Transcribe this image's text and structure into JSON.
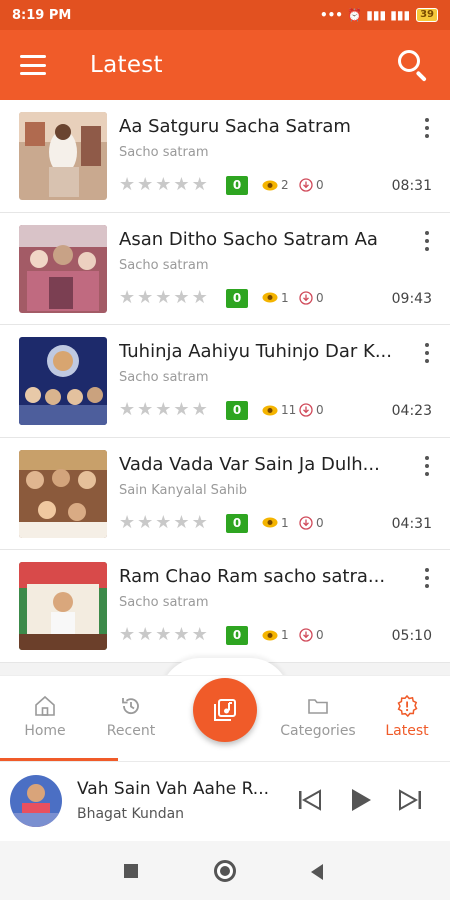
{
  "status_bar": {
    "time": "8:19 PM",
    "indicators": "••• ⏰ ▮▮▮ ▮▮▮",
    "battery": "39"
  },
  "app_bar": {
    "title": "Latest",
    "menu_icon": "menu-icon",
    "search_icon": "search-icon"
  },
  "colors": {
    "accent": "#f05b29",
    "badge": "#2ea521"
  },
  "songs": [
    {
      "title": "Aa Satguru Sacha Satram",
      "artist": "Sacho satram",
      "rating": "0",
      "views": "2",
      "downloads": "0",
      "duration": "08:31"
    },
    {
      "title": "Asan Ditho Sacho Satram Aa",
      "artist": "Sacho satram",
      "rating": "0",
      "views": "1",
      "downloads": "0",
      "duration": "09:43"
    },
    {
      "title": "Tuhinja Aahiyu Tuhinjo Dar K...",
      "artist": "Sacho satram",
      "rating": "0",
      "views": "11",
      "downloads": "0",
      "duration": "04:23"
    },
    {
      "title": "Vada Vada Var Sain Ja Dulh...",
      "artist": "Sain Kanyalal Sahib",
      "rating": "0",
      "views": "1",
      "downloads": "0",
      "duration": "04:31"
    },
    {
      "title": "Ram Chao Ram sacho satra...",
      "artist": "Sacho satram",
      "rating": "0",
      "views": "1",
      "downloads": "0",
      "duration": "05:10"
    }
  ],
  "bottom_nav": {
    "home": "Home",
    "recent": "Recent",
    "categories": "Categories",
    "latest": "Latest",
    "active": "Latest"
  },
  "player": {
    "title": "Vah Sain Vah Aahe R...",
    "artist": "Bhagat Kundan"
  }
}
